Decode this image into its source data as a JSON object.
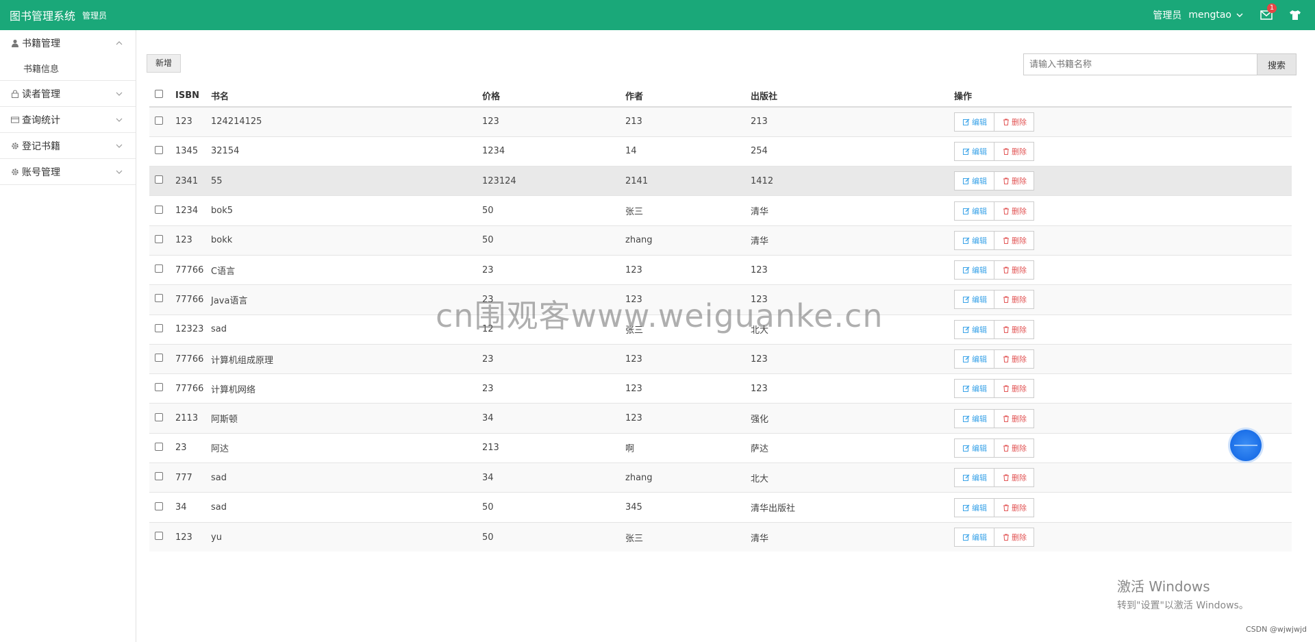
{
  "header": {
    "brand": "图书管理系统",
    "brand_sub": "管理员",
    "role": "管理员",
    "username": "mengtao",
    "mail_badge": "1",
    "bg_color": "#1aa879"
  },
  "sidebar": {
    "groups": [
      {
        "label": "书籍管理",
        "icon": "user-icon",
        "expanded": true,
        "items": [
          {
            "label": "书籍信息"
          }
        ]
      },
      {
        "label": "读者管理",
        "icon": "lock-icon",
        "expanded": false
      },
      {
        "label": "查询统计",
        "icon": "card-icon",
        "expanded": false
      },
      {
        "label": "登记书籍",
        "icon": "gear-icon",
        "expanded": false
      },
      {
        "label": "账号管理",
        "icon": "gear-icon",
        "expanded": false
      }
    ]
  },
  "toolbar": {
    "add_label": "新增",
    "search_placeholder": "请输入书籍名称",
    "search_label": "搜索"
  },
  "table": {
    "headers": {
      "isbn": "ISBN",
      "name": "书名",
      "price": "价格",
      "author": "作者",
      "publisher": "出版社",
      "ops": "操作"
    },
    "edit_label": "编辑",
    "delete_label": "删除",
    "rows": [
      {
        "isbn": "123",
        "name": "124214125",
        "price": "123",
        "author": "213",
        "publisher": "213"
      },
      {
        "isbn": "1345",
        "name": "32154",
        "price": "1234",
        "author": "14",
        "publisher": "254"
      },
      {
        "isbn": "2341",
        "name": "55",
        "price": "123124",
        "author": "2141",
        "publisher": "1412"
      },
      {
        "isbn": "1234",
        "name": "bok5",
        "price": "50",
        "author": "张三",
        "publisher": "清华"
      },
      {
        "isbn": "123",
        "name": "bokk",
        "price": "50",
        "author": "zhang",
        "publisher": "清华"
      },
      {
        "isbn": "77766",
        "name": "C语言",
        "price": "23",
        "author": "123",
        "publisher": "123"
      },
      {
        "isbn": "77766",
        "name": "Java语言",
        "price": "23",
        "author": "123",
        "publisher": "123"
      },
      {
        "isbn": "12323",
        "name": "sad",
        "price": "12",
        "author": "张三",
        "publisher": "北大"
      },
      {
        "isbn": "77766",
        "name": "计算机组成原理",
        "price": "23",
        "author": "123",
        "publisher": "123"
      },
      {
        "isbn": "77766",
        "name": "计算机网络",
        "price": "23",
        "author": "123",
        "publisher": "123"
      },
      {
        "isbn": "2113",
        "name": "阿斯顿",
        "price": "34",
        "author": "123",
        "publisher": "强化"
      },
      {
        "isbn": "23",
        "name": "阿达",
        "price": "213",
        "author": "啊",
        "publisher": "萨达"
      },
      {
        "isbn": "777",
        "name": "sad",
        "price": "34",
        "author": "zhang",
        "publisher": "北大"
      },
      {
        "isbn": "34",
        "name": "sad",
        "price": "50",
        "author": "345",
        "publisher": "清华出版社"
      },
      {
        "isbn": "123",
        "name": "yu",
        "price": "50",
        "author": "张三",
        "publisher": "清华"
      }
    ]
  },
  "watermark": "cn围观客www.weiguanke.cn",
  "activation": {
    "title": "激活 Windows",
    "subtitle": "转到\"设置\"以激活 Windows。"
  },
  "csdn": "CSDN @wjwjwjd",
  "colors": {
    "edit": "#3aa3e8",
    "delete": "#e25555",
    "fab": "#1b6fe8"
  }
}
